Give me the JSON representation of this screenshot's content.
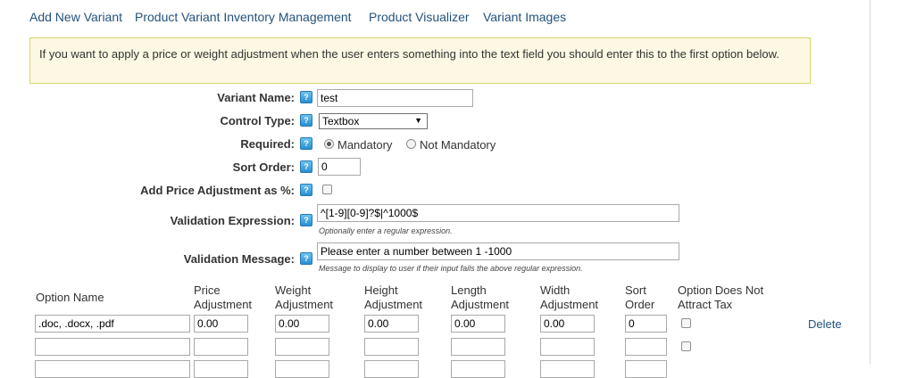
{
  "tabs": [
    "Add New Variant",
    "Product Variant Inventory Management",
    "Product Visualizer",
    "Variant Images"
  ],
  "notice": "If you want to apply a price or weight adjustment when the user enters something into the text field you should enter this to the first option below.",
  "help_icon_glyph": "?",
  "form": {
    "variant_name": {
      "label": "Variant Name:",
      "value": "test"
    },
    "control_type": {
      "label": "Control Type:",
      "value": "Textbox"
    },
    "required": {
      "label": "Required:",
      "options": [
        "Mandatory",
        "Not Mandatory"
      ],
      "selected": "Mandatory"
    },
    "sort_order": {
      "label": "Sort Order:",
      "value": "0"
    },
    "price_adj_percent": {
      "label": "Add Price Adjustment as %:",
      "checked": false
    },
    "validation_expression": {
      "label": "Validation Expression:",
      "value": "^[1-9][0-9]?$|^1000$",
      "hint": "Optionally enter a regular expression."
    },
    "validation_message": {
      "label": "Validation Message:",
      "value": "Please enter a number between 1 -1000",
      "hint": "Message to display to user if their input fails the above regular expression."
    }
  },
  "options_table": {
    "headers": {
      "option_name": "Option Name",
      "price": [
        "Price",
        "Adjustment"
      ],
      "weight": [
        "Weight",
        "Adjustment"
      ],
      "height": [
        "Height",
        "Adjustment"
      ],
      "length": [
        "Length",
        "Adjustment"
      ],
      "width": [
        "Width",
        "Adjustment"
      ],
      "sort": [
        "Sort",
        "Order"
      ],
      "no_tax": [
        "Option Does Not",
        "Attract Tax"
      ]
    },
    "rows": [
      {
        "name": ".doc, .docx, .pdf",
        "price": "0.00",
        "weight": "0.00",
        "height": "0.00",
        "length": "0.00",
        "width": "0.00",
        "sort": "0",
        "no_tax": false,
        "action": "Delete"
      },
      {
        "name": "",
        "price": "",
        "weight": "",
        "height": "",
        "length": "",
        "width": "",
        "sort": "",
        "no_tax": false,
        "action": ""
      }
    ]
  },
  "colors": {
    "link": "#23527c",
    "notice_bg": "#fcf8e3",
    "notice_border": "#d6d66c"
  }
}
